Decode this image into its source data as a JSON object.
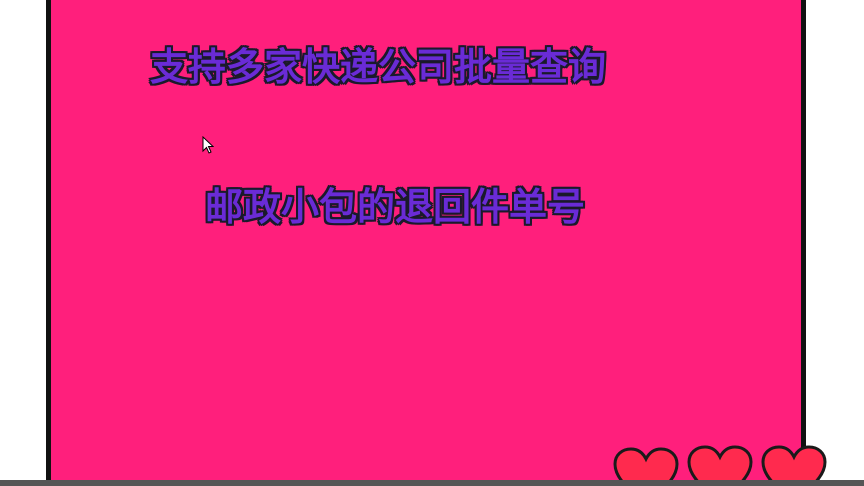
{
  "slide": {
    "caption_line_1": "支持多家快递公司批量查询",
    "caption_line_2": "邮政小包的退回件单号"
  },
  "colors": {
    "panel_background": "#ff1f7c",
    "caption_fill": "#6a2bd6",
    "caption_outline": "#1a1a2a",
    "heart_fill": "#ff2a4e",
    "frame_border": "#111111"
  },
  "icons": {
    "cursor": "mouse-pointer-icon",
    "decoration": "heart-icon"
  }
}
